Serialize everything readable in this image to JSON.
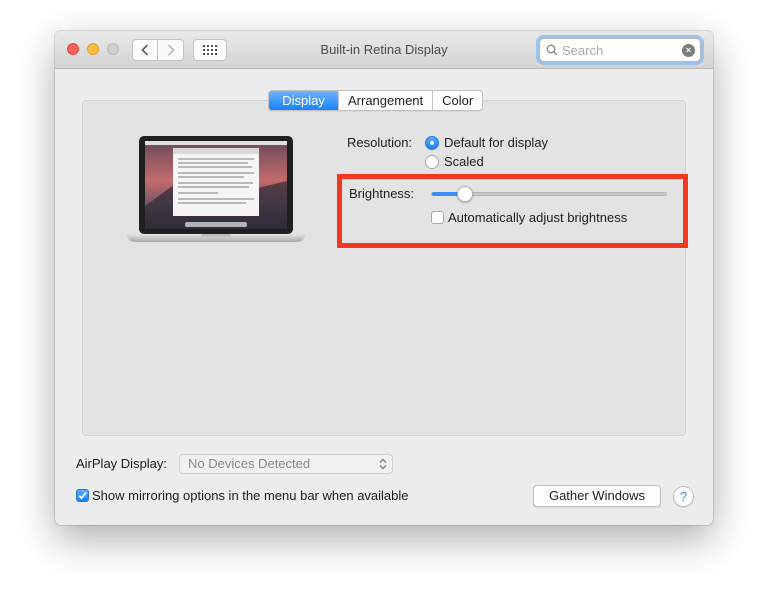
{
  "window": {
    "title": "Built-in Retina Display"
  },
  "search": {
    "placeholder": "Search"
  },
  "tabs": [
    {
      "label": "Display",
      "active": true
    },
    {
      "label": "Arrangement",
      "active": false
    },
    {
      "label": "Color",
      "active": false
    }
  ],
  "display": {
    "resolution_label": "Resolution:",
    "resolution_options": [
      {
        "label": "Default for display",
        "selected": true
      },
      {
        "label": "Scaled",
        "selected": false
      }
    ],
    "brightness_label": "Brightness:",
    "brightness_level": 0.14,
    "auto_brightness_label": "Automatically adjust brightness",
    "auto_brightness_checked": false
  },
  "airplay": {
    "label": "AirPlay Display:",
    "selected": "No Devices Detected"
  },
  "mirroring": {
    "label": "Show mirroring options in the menu bar when available",
    "checked": true
  },
  "buttons": {
    "gather_windows": "Gather Windows",
    "help": "?"
  },
  "colors": {
    "accent": "#1a82fb",
    "highlight_box": "#f2391f"
  }
}
